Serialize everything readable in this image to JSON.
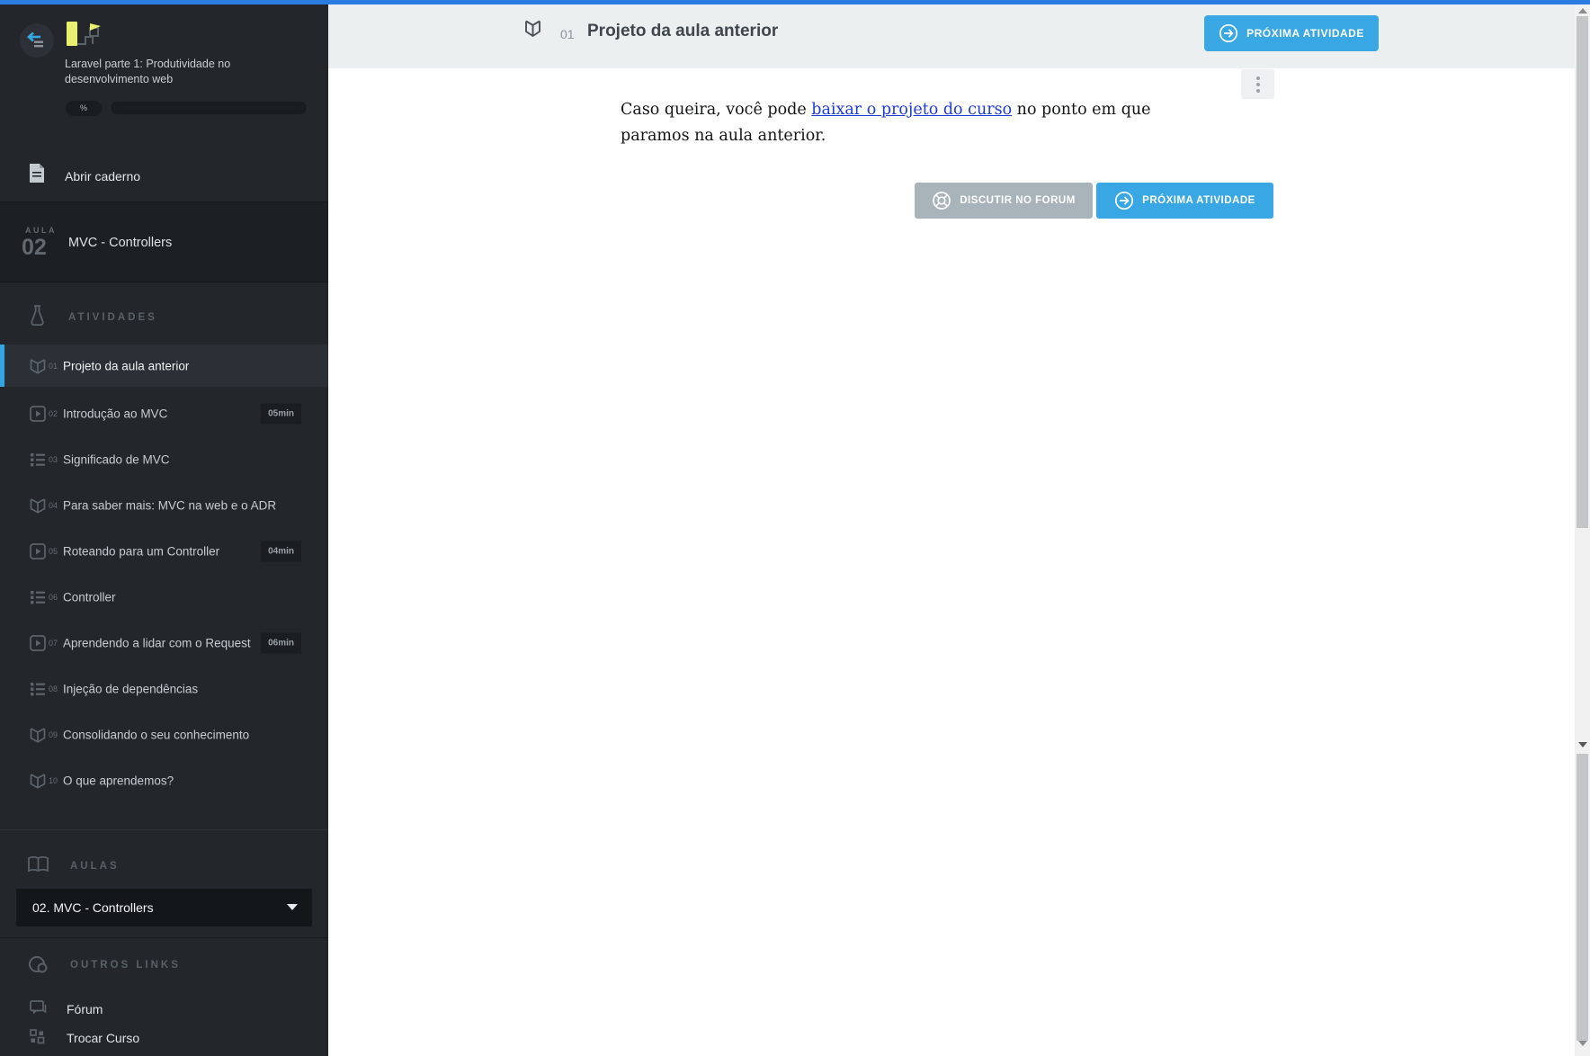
{
  "colors": {
    "topbar_blue": "#2a7ce1",
    "accent_blue": "#38a7e3",
    "active_bar_blue": "#33a5e2",
    "sidebar_bg": "#23272b",
    "header_bg": "#eceff0",
    "forum_gray": "#a9b4ba",
    "link_blue": "#1f3bd6"
  },
  "sidebar": {
    "collapse_icon": "collapse-sidebar-icon",
    "logo_icon": "course-logo",
    "course_title": "Laravel parte 1: Produtividade no desenvolvimento web",
    "progress_percent_label": "%",
    "notebook": {
      "icon": "notebook-file-icon",
      "label": "Abrir caderno"
    },
    "lesson": {
      "word": "AULA",
      "number": "02",
      "title": "MVC - Controllers"
    },
    "activities_header": {
      "icon": "flask-icon",
      "label": "ATIVIDADES"
    },
    "activities": [
      {
        "num": "01",
        "label": "Projeto da aula anterior",
        "icon": "book-icon",
        "active": true
      },
      {
        "num": "02",
        "label": "Introdução ao MVC",
        "icon": "video-icon",
        "duration": "05min"
      },
      {
        "num": "03",
        "label": "Significado de MVC",
        "icon": "list-icon"
      },
      {
        "num": "04",
        "label": "Para saber mais: MVC na web e o ADR",
        "icon": "book-icon"
      },
      {
        "num": "05",
        "label": "Roteando para um Controller",
        "icon": "video-icon",
        "duration": "04min"
      },
      {
        "num": "06",
        "label": "Controller",
        "icon": "list-icon"
      },
      {
        "num": "07",
        "label": "Aprendendo a lidar com o Request",
        "icon": "video-icon",
        "duration": "06min"
      },
      {
        "num": "08",
        "label": "Injeção de dependências",
        "icon": "list-icon"
      },
      {
        "num": "09",
        "label": "Consolidando o seu conhecimento",
        "icon": "book-icon"
      },
      {
        "num": "10",
        "label": "O que aprendemos?",
        "icon": "book-icon"
      }
    ],
    "aulas_header": {
      "icon": "open-book-icon",
      "label": "AULAS"
    },
    "aulas_select_value": "02. MVC - Controllers",
    "other_links_header": {
      "icon": "link-icon",
      "label": "OUTROS LINKS"
    },
    "other_links": [
      {
        "icon": "chat-icon",
        "label": "Fórum"
      },
      {
        "icon": "grid-icon",
        "label": "Trocar Curso"
      }
    ]
  },
  "header": {
    "activity_icon": "book-icon",
    "activity_number": "01",
    "title": "Projeto da aula anterior",
    "next_button_label": "PRÓXIMA ATIVIDADE"
  },
  "content": {
    "kebab_icon": "kebab-menu-icon",
    "paragraph_prefix": "Caso queira, você pode ",
    "link_text": "baixar o projeto do curso",
    "paragraph_suffix": " no ponto em que paramos na aula anterior.",
    "forum_button_label": "DISCUTIR NO FORUM",
    "forum_button_icon": "lifebuoy-icon",
    "next_button_label": "PRÓXIMA ATIVIDADE",
    "next_button_icon": "arrow-right-circle-icon"
  }
}
